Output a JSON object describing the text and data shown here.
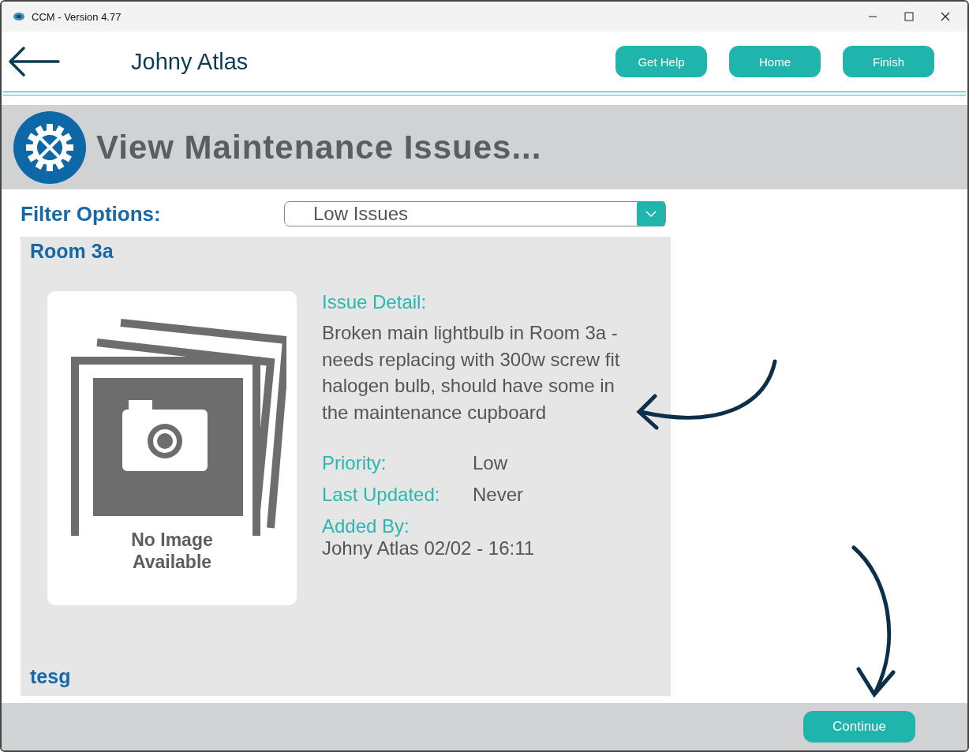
{
  "window": {
    "title": "CCM - Version 4.77"
  },
  "header": {
    "user": "Johny Atlas",
    "buttons": [
      "Get Help",
      "Home",
      "Finish"
    ]
  },
  "banner": {
    "title": "View Maintenance Issues..."
  },
  "filter": {
    "label": "Filter Options:",
    "value": "Low Issues"
  },
  "issue": {
    "room": "Room 3a",
    "image_caption": "No Image Available",
    "detail_label": "Issue Detail:",
    "detail": "Broken main lightbulb in Room 3a - needs replacing with 300w screw fit halogen bulb, should have some in the maintenance cupboard",
    "fields": [
      {
        "label": "Priority:",
        "value": "Low"
      },
      {
        "label": "Last Updated:",
        "value": "Never"
      }
    ],
    "added_by_label": "Added By:",
    "added_by": "Johny Atlas 02/02 - 16:11",
    "tag": "tesg"
  },
  "footer": {
    "button": "Continue"
  }
}
